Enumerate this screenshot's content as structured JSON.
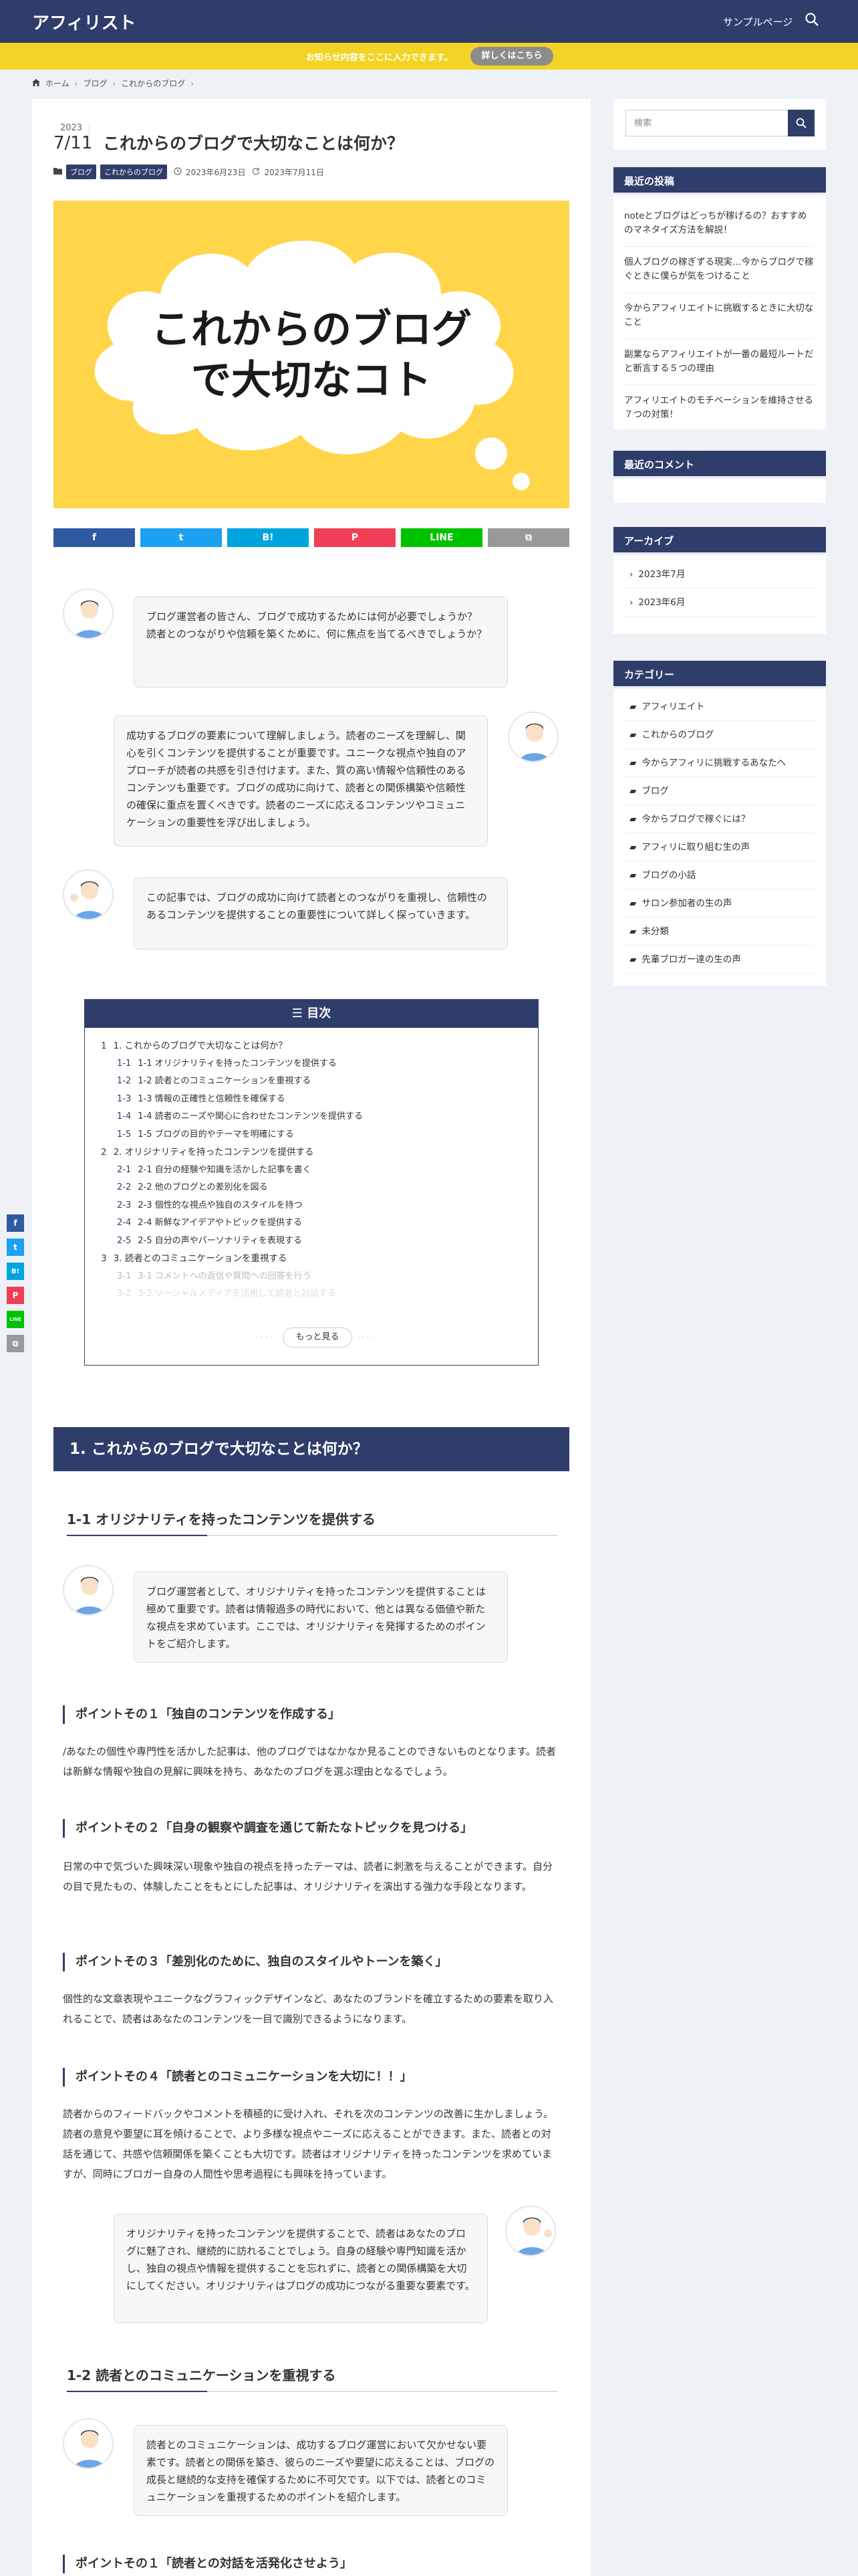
{
  "header": {
    "logo": "アフィリスト",
    "nav_link": "サンプルページ",
    "search_icon": "search-icon"
  },
  "notice": {
    "text": "お知らせ内容をここに入力できます。",
    "button": "詳しくはこちら"
  },
  "breadcrumb": {
    "home": "ホーム",
    "blog": "ブログ",
    "current": "これからのブログ"
  },
  "post": {
    "year": "2023",
    "month_day": "7/11",
    "title": "これからのブログで大切なことは何か？",
    "categories": [
      "ブログ",
      "これからのブログ"
    ],
    "published": "2023年6月23日",
    "updated": "2023年7月11日",
    "eyecatch_line1": "これからのブログ",
    "eyecatch_line2": "で大切なコト"
  },
  "share": {
    "facebook": "f",
    "twitter": "t",
    "hatena": "B!",
    "pocket": "P",
    "line": "LINE",
    "copy": "⧉"
  },
  "speech": {
    "s1": "ブログ運営者の皆さん、ブログで成功するためには何が必要でしょうか？\n読者とのつながりや信頼を築くために、何に焦点を当てるべきでしょうか？",
    "s2": "成功するブログの要素について理解しましょう。読者のニーズを理解し、関心を引くコンテンツを提供することが重要です。ユニークな視点や独自のアプローチが読者の共感を引き付けます。また、質の高い情報や信頼性のあるコンテンツも重要です。ブログの成功に向けて、読者との関係構築や信頼性の確保に重点を置くべきです。読者のニーズに応えるコンテンツやコミュニケーションの重要性を浮び出しましょう。",
    "s3": "この記事では、ブログの成功に向けて読者とのつながりを重視し、信頼性のあるコンテンツを提供することの重要性について詳しく探っていきます。",
    "s4": "ブログ運営者として、オリジナリティを持ったコンテンツを提供することは極めて重要です。読者は情報過多の時代において、他とは異なる価値や新たな視点を求めています。ここでは、オリジナリティを発揮するためのポイントをご紹介します。",
    "s5": "オリジナリティを持ったコンテンツを提供することで、読者はあなたのブログに魅了され、継続的に訪れることでしょう。自身の経験や専門知識を活かし、独自の視点や情報を提供することを忘れずに、読者との関係構築を大切にしてください。オリジナリティはブログの成功につながる重要な要素です。",
    "s6": "読者とのコミュニケーションは、成功するブログ運営において欠かせない要素です。読者との関係を築き、彼らのニーズや要望に応えることは、ブログの成長と継続的な支持を確保するために不可欠です。以下では、読者とのコミュニケーションを重視するためのポイントを紹介します。"
  },
  "toc": {
    "title": "目次",
    "items": [
      {
        "num": "1",
        "label": "1. これからのブログで大切なことは何か？",
        "level": 2
      },
      {
        "num": "1-1",
        "label": "1-1 オリジナリティを持ったコンテンツを提供する",
        "level": 3
      },
      {
        "num": "1-2",
        "label": "1-2 読者とのコミュニケーションを重視する",
        "level": 3
      },
      {
        "num": "1-3",
        "label": "1-3 情報の正確性と信頼性を確保する",
        "level": 3
      },
      {
        "num": "1-4",
        "label": "1-4 読者のニーズや関心に合わせたコンテンツを提供する",
        "level": 3
      },
      {
        "num": "1-5",
        "label": "1-5 ブログの目的やテーマを明確にする",
        "level": 3
      },
      {
        "num": "2",
        "label": "2. オリジナリティを持ったコンテンツを提供する",
        "level": 2
      },
      {
        "num": "2-1",
        "label": "2-1 自分の経験や知識を活かした記事を書く",
        "level": 3
      },
      {
        "num": "2-2",
        "label": "2-2 他のブログとの差別化を図る",
        "level": 3
      },
      {
        "num": "2-3",
        "label": "2-3 個性的な視点や独自のスタイルを持つ",
        "level": 3
      },
      {
        "num": "2-4",
        "label": "2-4 新鮮なアイデアやトピックを提供する",
        "level": 3
      },
      {
        "num": "2-5",
        "label": "2-5 自分の声やパーソナリティを表現する",
        "level": 3
      },
      {
        "num": "3",
        "label": "3. 読者とのコミュニケーションを重視する",
        "level": 2
      },
      {
        "num": "3-1",
        "label": "3-1 コメントへの返信や質問への回答を行う",
        "level": 3
      },
      {
        "num": "3-2",
        "label": "3-2 ソーシャルメディアを活用して読者と対話する",
        "level": 3
      }
    ],
    "more": "もっと見る"
  },
  "content": {
    "h2": "1. これからのブログで大切なことは何か？",
    "h3_1": "1-1 オリジナリティを持ったコンテンツを提供する",
    "p1_title": "ポイントその１「独自のコンテンツを作成する」",
    "p1_text": "/あなたの個性や専門性を活かした記事は、他のブログではなかなか見ることのできないものとなります。読者は新鮮な情報や独自の見解に興味を持ち、あなたのブログを選ぶ理由となるでしょう。",
    "p2_title": "ポイントその２「自身の観察や調査を通じて新たなトピックを見つける」",
    "p2_text": "日常の中で気づいた興味深い現象や独自の視点を持ったテーマは、読者に刺激を与えることができます。自分の目で見たもの、体験したことをもとにした記事は、オリジナリティを演出する強力な手段となります。",
    "p3_title": "ポイントその３「差別化のために、独自のスタイルやトーンを築く」",
    "p3_text": "個性的な文章表現やユニークなグラフィックデザインなど、あなたのブランドを確立するための要素を取り入れることで、読者はあなたのコンテンツを一目で識別できるようになります。",
    "p4_title": "ポイントその４「読者とのコミュニケーションを大切に！！」",
    "p4_text": "読者からのフィードバックやコメントを積極的に受け入れ、それを次のコンテンツの改善に生かしましょう。読者の意見や要望に耳を傾けることで、より多様な視点やニーズに応えることができます。また、読者との対話を通じて、共感や信頼関係を築くことも大切です。読者はオリジナリティを持ったコンテンツを求めていますが、同時にブロガー自身の人間性や思考過程にも興味を持っています。",
    "h3_2": "1-2 読者とのコミュニケーションを重視する",
    "p5_title": "ポイントその１「読者との対話を活発化させよう」"
  },
  "sidebar": {
    "search_placeholder": "検索",
    "recent_title": "最近の投稿",
    "recent": [
      "noteとブログはどっちが稼げるの？おすすめのマネタイズ方法を解説！",
      "個人ブログの稼ぎずる現実…今からブログで稼ぐときに僕らが気をつけること",
      "今からアフィリエイトに挑戦するときに大切なこと",
      "副業ならアフィリエイトが一番の最短ルートだと断言する５つの理由",
      "アフィリエイトのモチベーションを維持させる７つの対策！"
    ],
    "comments_title": "最近のコメント",
    "archive_title": "アーカイブ",
    "archives": [
      "2023年7月",
      "2023年6月"
    ],
    "category_title": "カテゴリー",
    "categories": [
      "アフィリエイト",
      "これからのブログ",
      "今からアフィリに挑戦するあなたへ",
      "ブログ",
      "今からブログで稼ぐには？",
      "アフィリに取り組む生の声",
      "ブログの小話",
      "サロン参加者の生の声",
      "未分類",
      "先輩ブロガー達の生の声"
    ]
  },
  "colors": {
    "navy": "#2f3d6b",
    "yellow": "#f3d424",
    "facebook": "#2f5aa0",
    "twitter": "#1da1f2",
    "hatena": "#00a4de",
    "pocket": "#ef4056",
    "line": "#00c300",
    "copy": "#999999"
  }
}
